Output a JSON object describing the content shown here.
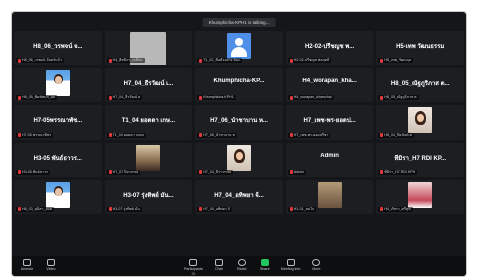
{
  "speaking_banner": "Khumphicha-KPH1 is talking...",
  "tiles": [
    {
      "big": "H8_06_วรพจน์ จ...",
      "foot": "H8_06_วรพจน์ จันทร์แก้ว",
      "pic": ""
    },
    {
      "big": "",
      "foot": "H4_สิทธิกร_เคมีพล",
      "pic": "gray"
    },
    {
      "big": "",
      "foot": "T1_02_ชื่อตัวอย่าง ห้อง",
      "pic": "blue"
    },
    {
      "big": "H2-02-ปรีชญช พ...",
      "foot": "H2-02-ปรีชญช พลฤทธิ์",
      "pic": ""
    },
    {
      "big": "H5-เทพ วัฒนธรรม",
      "foot": "H5_เทพ_รัฒนกุล",
      "pic": ""
    },
    {
      "big": "",
      "foot": "H8_05_พิมพ์ชนก_ผล",
      "pic": "portrait"
    },
    {
      "big": "H7_04_ธีรวัฒน์ เ...",
      "foot": "H7_04_ธีรวัฒน์ ส",
      "pic": ""
    },
    {
      "big": "Khumphicha-KP...",
      "foot": "Khumphicha-KPH1",
      "pic": ""
    },
    {
      "big": "H4_worapan_kha...",
      "foot": "H4_worapan_khamchai",
      "pic": ""
    },
    {
      "big": "H8_05_ณัฐภูริภาส ต...",
      "foot": "H8_05_ณัฐภูริภาส ต",
      "pic": ""
    },
    {
      "big": "H7-05พรรณาพัช...",
      "foot": "H7-05 พรรณาพัชร",
      "pic": ""
    },
    {
      "big": "T1_04 ยอดดา เกษ...",
      "foot": "T1_04 ยอดดา เกษม",
      "pic": ""
    },
    {
      "big": "H7_06_นำชาบาน ห...",
      "foot": "H7_06_นำชาบาน ห",
      "pic": ""
    },
    {
      "big": "H7_เพช-พร-ยอดป...",
      "foot": "H7_เพช-พร-ยอดปรีชา",
      "pic": ""
    },
    {
      "big": "",
      "foot": "H8_04_ปิยนันท์ ศ",
      "pic": "woman"
    },
    {
      "big": "H3-05 พันธ์ธาวร...",
      "foot": "H3-05 พันธ์ธาวร",
      "pic": ""
    },
    {
      "big": "",
      "foot": "H7_07 ปิยาภรณ์",
      "pic": "room"
    },
    {
      "big": "",
      "foot": "H7_04_ธีราวรรณ",
      "pic": "woman"
    },
    {
      "big": "Admin",
      "foot": "Admin",
      "pic": ""
    },
    {
      "big": "ทีมิรา_H7 RDI KP...",
      "foot": "ทีมิรา_H7 RDI KPH",
      "pic": ""
    },
    {
      "big": "",
      "foot": "H8_03_สุนิสา_ยอด",
      "pic": "portrait"
    },
    {
      "big": "H3-07 รุ่งทิพย์ มัน...",
      "foot": "H3-07 รุ่งทิพย์ มัน",
      "pic": ""
    },
    {
      "big": "H7_04_อทิพยา จ้...",
      "foot": "H7_04_อทิพยา จ้",
      "pic": ""
    },
    {
      "big": "",
      "foot": "H1-01_สมใจ",
      "pic": "shelf"
    },
    {
      "big": "",
      "foot": "H4_ภัทรา_ศรีสุข",
      "pic": "pink"
    }
  ],
  "toolbar": {
    "left": [
      {
        "label": "Unmute",
        "icon": "microphone-icon"
      },
      {
        "label": "Video",
        "icon": "video-icon"
      }
    ],
    "center": [
      {
        "label": "Participants",
        "icon": "participants-icon",
        "count": "38"
      },
      {
        "label": "Chat",
        "icon": "chat-icon",
        "count": ""
      },
      {
        "label": "React",
        "icon": "react-icon",
        "count": ""
      },
      {
        "label": "Share",
        "icon": "share-icon",
        "count": ""
      },
      {
        "label": "Meeting info",
        "icon": "info-icon",
        "count": ""
      },
      {
        "label": "More",
        "icon": "more-icon",
        "count": ""
      }
    ]
  }
}
